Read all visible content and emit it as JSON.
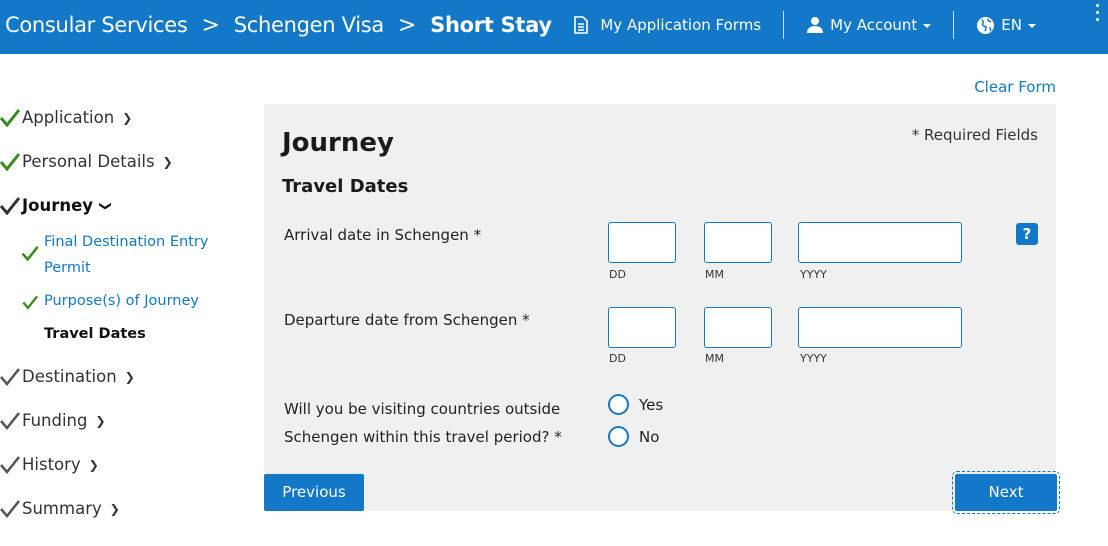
{
  "header": {
    "breadcrumbs": [
      "Consular Services",
      "Schengen Visa",
      "Short Stay"
    ],
    "separator": ">",
    "nav": {
      "application_forms": "My Application Forms",
      "account": "My Account",
      "language": "EN"
    }
  },
  "clear_form": "Clear Form",
  "sidebar": {
    "steps": [
      {
        "label": "Application",
        "status": "done"
      },
      {
        "label": "Personal Details",
        "status": "done"
      },
      {
        "label": "Journey",
        "status": "active"
      },
      {
        "label": "Destination",
        "status": "done"
      },
      {
        "label": "Funding",
        "status": "done"
      },
      {
        "label": "History",
        "status": "done"
      },
      {
        "label": "Summary",
        "status": "done"
      }
    ],
    "substeps": [
      {
        "line1": "Final Destination Entry",
        "line2": "Permit"
      },
      {
        "line1": "Purpose(s) of Journey"
      },
      {
        "line1": "Travel Dates"
      }
    ]
  },
  "form": {
    "title": "Journey",
    "required_note": "* Required Fields",
    "section": "Travel Dates",
    "arrival": {
      "label": "Arrival date in Schengen *",
      "dd": "",
      "mm": "",
      "yyyy": ""
    },
    "departure": {
      "label": "Departure date from Schengen *",
      "dd": "",
      "mm": "",
      "yyyy": ""
    },
    "captions": {
      "dd": "DD",
      "mm": "MM",
      "yyyy": "YYYY"
    },
    "help": "?",
    "question": {
      "line1": "Will you be visiting countries outside",
      "line2": "Schengen within this travel period? *",
      "options": [
        "Yes",
        "No"
      ]
    }
  },
  "buttons": {
    "previous": "Previous",
    "next": "Next"
  },
  "colors": {
    "primary": "#1378c8",
    "check": "#3a8a1e",
    "panel": "#f0f0f0"
  }
}
